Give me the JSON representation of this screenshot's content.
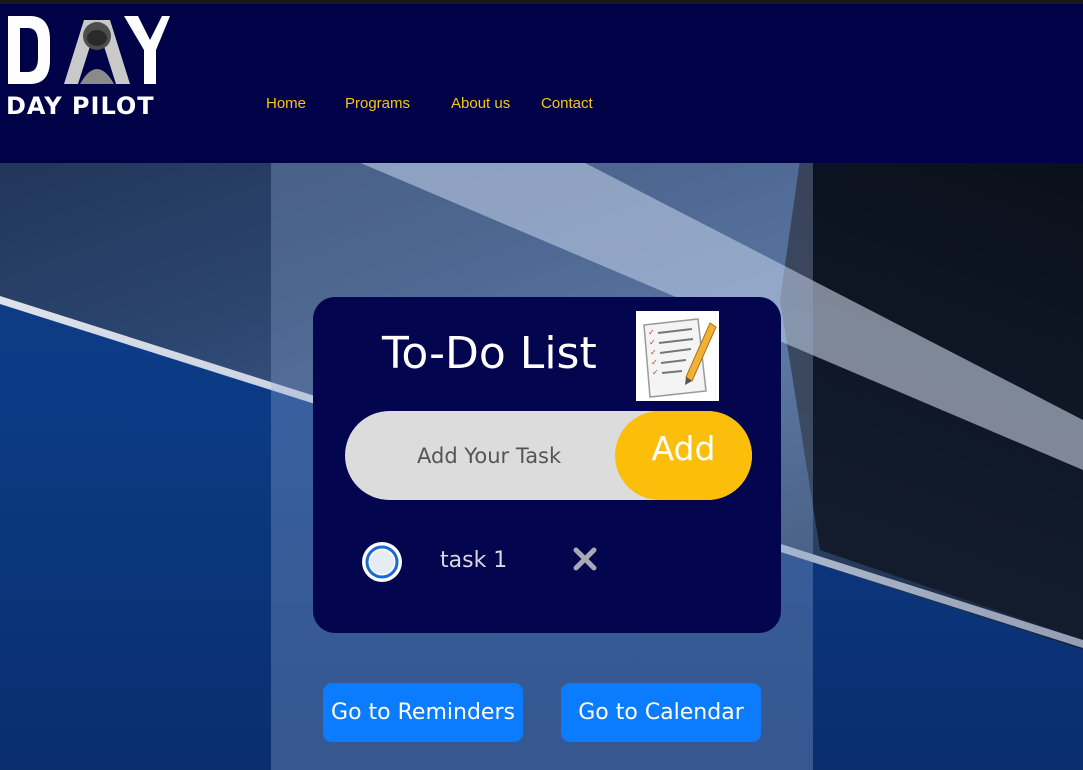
{
  "brand": {
    "logo_word": "DAY",
    "name": "DAY PILOT"
  },
  "nav": {
    "items": [
      {
        "label": "Home"
      },
      {
        "label": "Programs"
      },
      {
        "label": "About us"
      },
      {
        "label": "Contact"
      }
    ]
  },
  "todo": {
    "title": "To-Do List",
    "input_placeholder": "Add Your Task",
    "input_value": "",
    "add_label": "Add",
    "tasks": [
      {
        "text": "task 1",
        "done": false
      }
    ]
  },
  "actions": {
    "reminders_label": "Go to Reminders",
    "calendar_label": "Go to Calendar"
  },
  "colors": {
    "header_bg": "#000248",
    "nav_link": "#f5c518",
    "card_bg": "#03054e",
    "add_button": "#fbbf0b",
    "action_button": "#0c7cfe"
  },
  "icons": {
    "logo": "pilot-helmet-logo",
    "title_icon": "checklist-pencil-icon",
    "task_check": "radio-circle-icon",
    "task_delete": "close-icon"
  }
}
